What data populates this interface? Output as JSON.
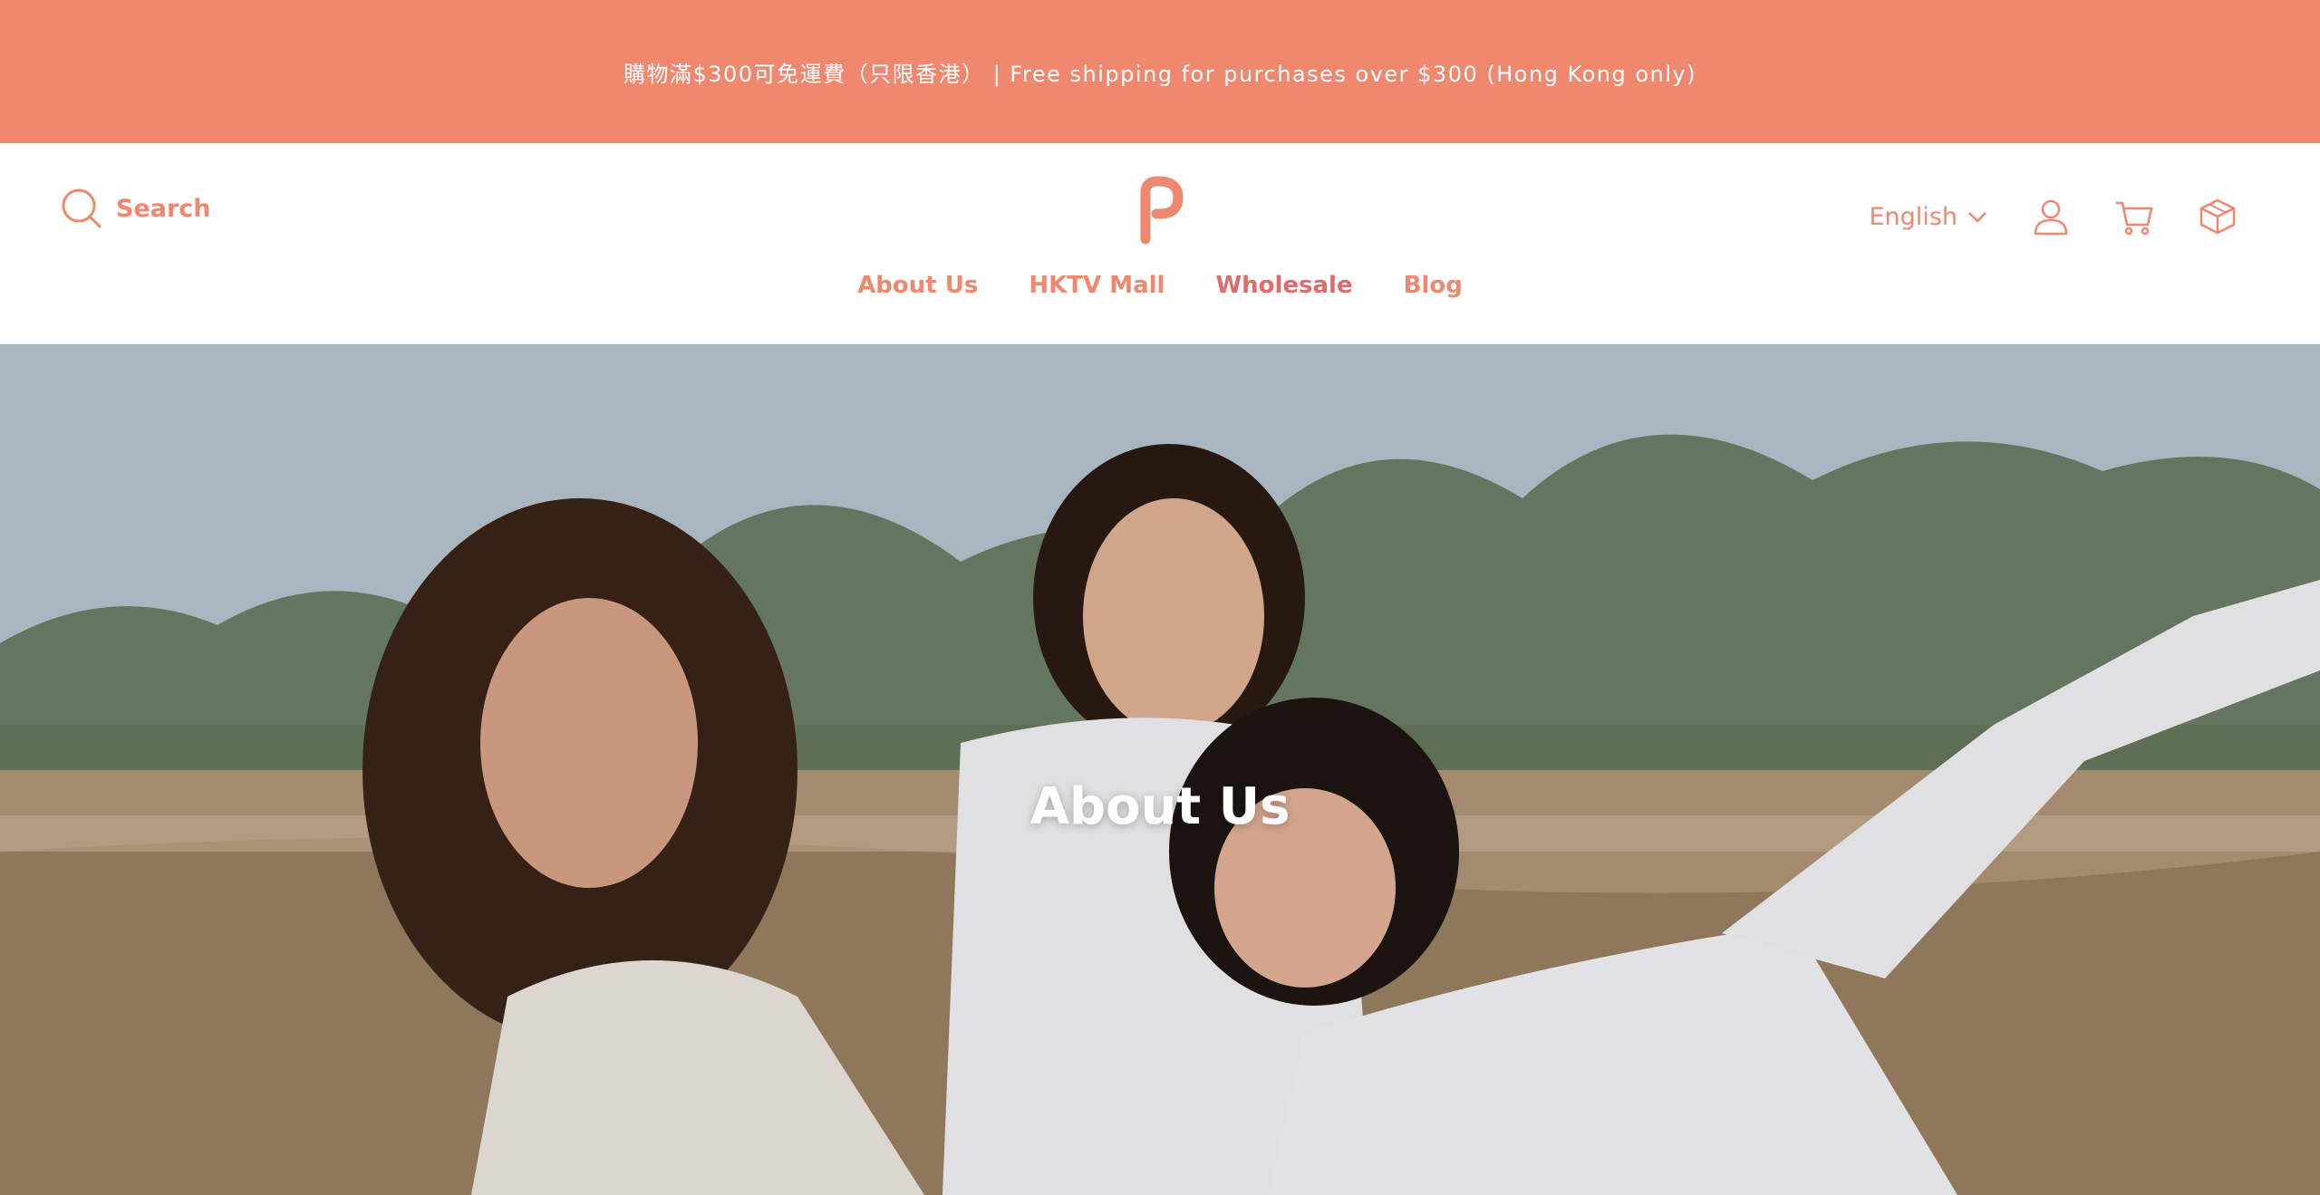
{
  "announcement": {
    "text": "購物滿$300可免運費（只限香港） | Free shipping for purchases over $300 (Hong Kong only)"
  },
  "header": {
    "search_label": "Search",
    "logo_icon": "brand-p-logo",
    "language": "English",
    "icons": [
      "search-icon",
      "chevron-down-icon",
      "user-icon",
      "cart-icon",
      "box-icon"
    ]
  },
  "nav": {
    "items": [
      {
        "label": "About Us"
      },
      {
        "label": "HKTV Mall"
      },
      {
        "label": "Wholesale"
      },
      {
        "label": "Blog"
      }
    ]
  },
  "hero": {
    "title": "About Us"
  },
  "colors": {
    "accent": "#f0876f",
    "announcement_bg": "#f0876f",
    "text_on_accent": "#ffffff"
  }
}
